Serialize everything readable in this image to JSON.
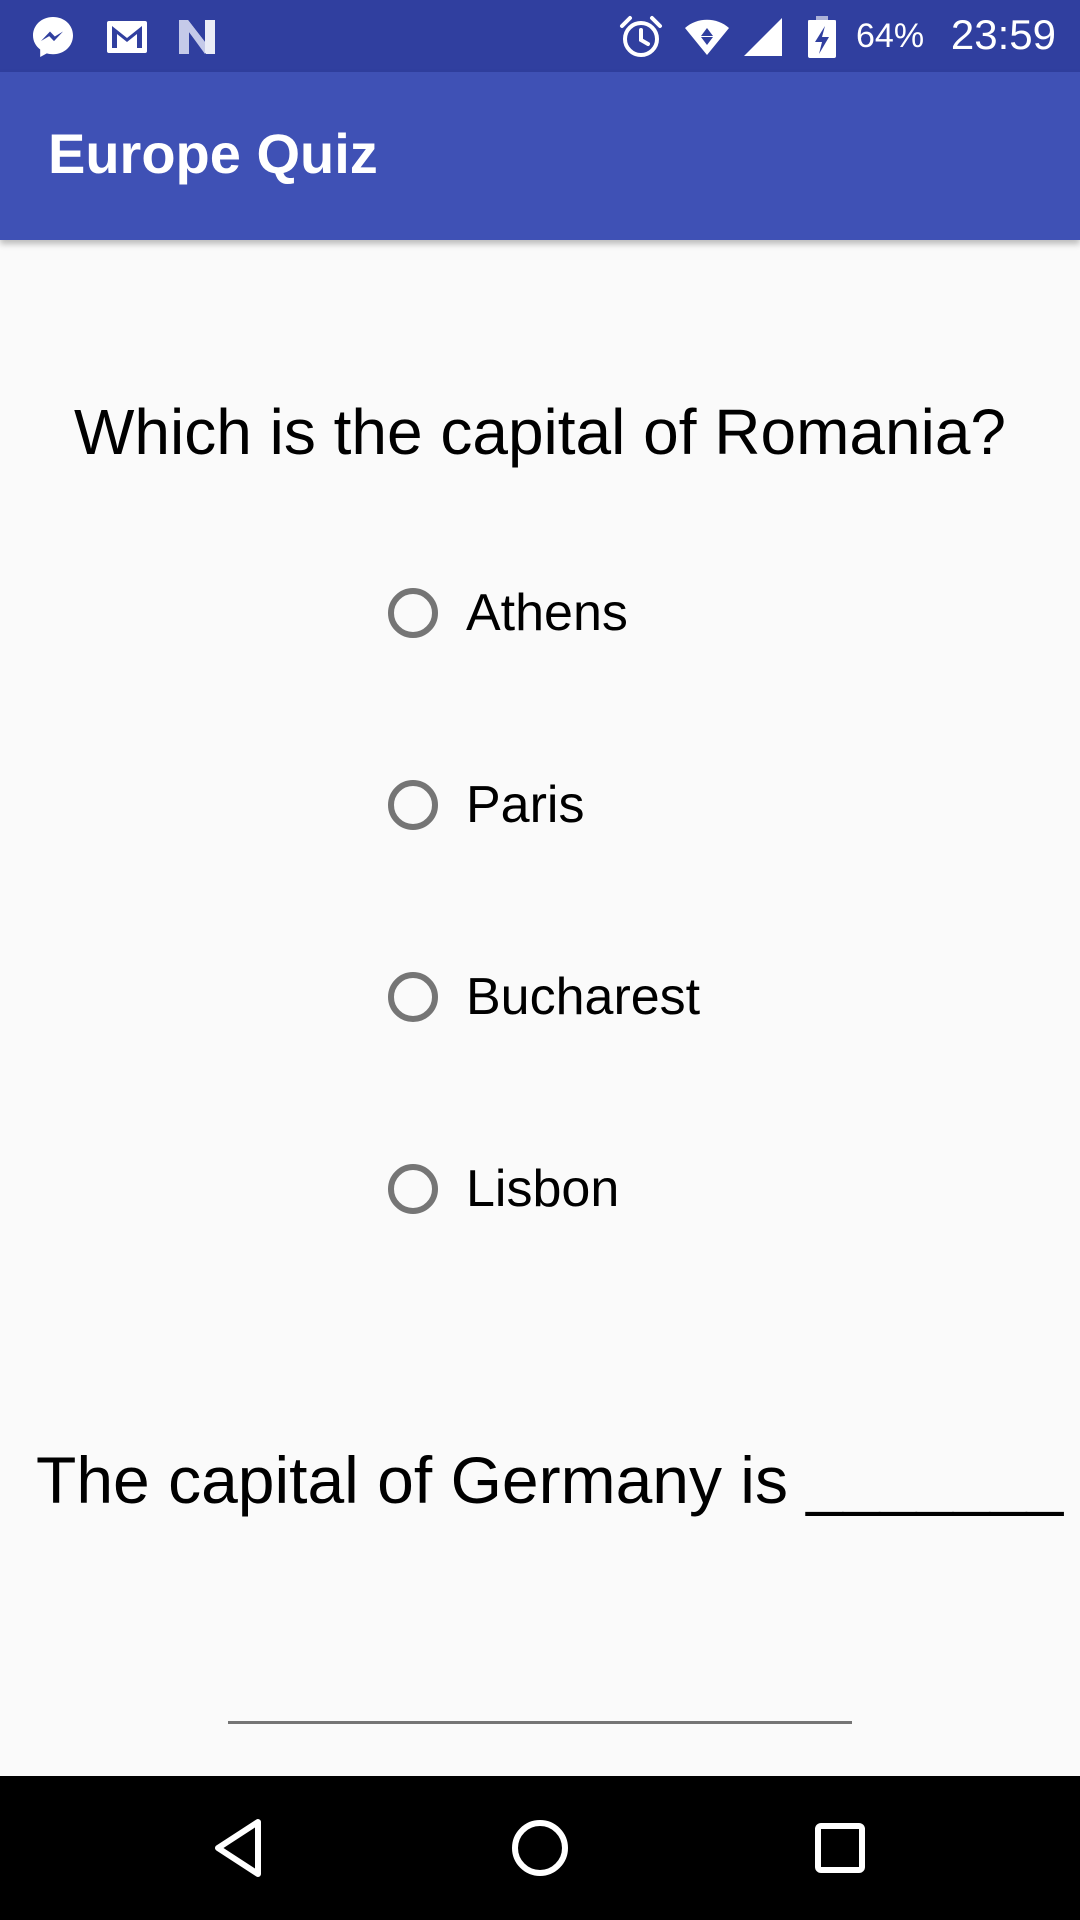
{
  "status_bar": {
    "battery_percent": "64%",
    "time": "23:59",
    "icons": [
      "messenger-icon",
      "gmail-icon",
      "n-icon",
      "alarm-icon",
      "wifi-icon",
      "signal-icon",
      "battery-charging-icon"
    ]
  },
  "app_bar": {
    "title": "Europe Quiz",
    "color": "#3f51b5",
    "status_color": "#303f9f"
  },
  "question1": {
    "text": "Which is the capital of Romania?",
    "options": [
      "Athens",
      "Paris",
      "Bucharest",
      "Lisbon"
    ]
  },
  "question2": {
    "text": "The capital of Germany is _______ .",
    "input_value": ""
  },
  "nav_bar": {
    "buttons": [
      "back-icon",
      "home-icon",
      "recents-icon"
    ]
  }
}
